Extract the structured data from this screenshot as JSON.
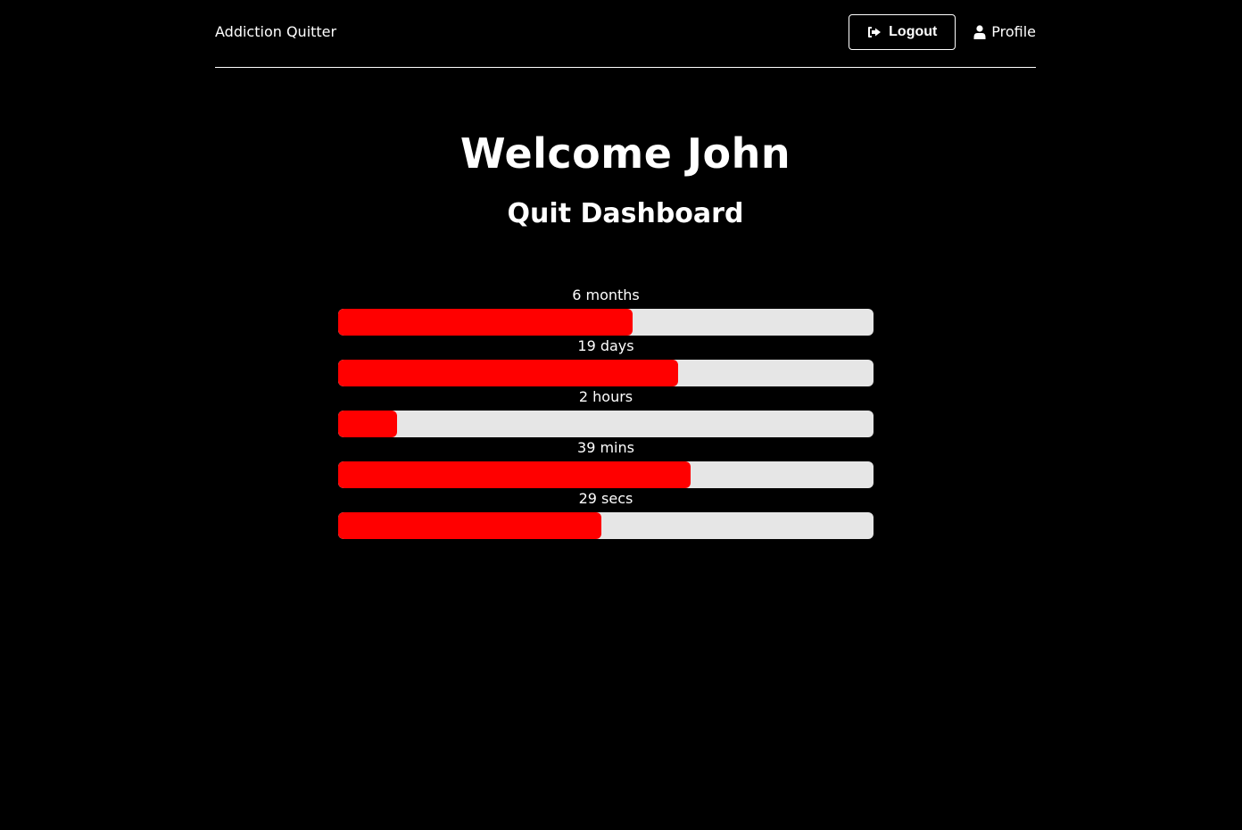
{
  "header": {
    "brand": "Addiction Quitter",
    "logout_label": "Logout",
    "profile_label": "Profile"
  },
  "main": {
    "welcome": "Welcome John",
    "subtitle": "Quit Dashboard"
  },
  "progress": [
    {
      "label": "6 months",
      "fraction": 0.55
    },
    {
      "label": "19 days",
      "fraction": 0.635
    },
    {
      "label": "2 hours",
      "fraction": 0.11
    },
    {
      "label": "39 mins",
      "fraction": 0.658
    },
    {
      "label": "29 secs",
      "fraction": 0.492
    }
  ],
  "colors": {
    "accent": "#ff0000",
    "track": "#e6e6e6",
    "background": "#000000",
    "text": "#ffffff"
  },
  "icons": {
    "logout": "sign-out-icon",
    "profile": "user-icon"
  }
}
